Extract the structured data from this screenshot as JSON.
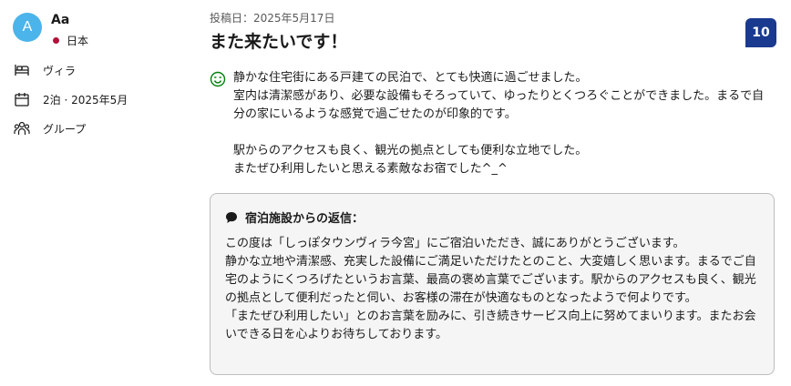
{
  "reviewer": {
    "avatar_initial": "A",
    "name": "Aa",
    "country": "日本"
  },
  "details": {
    "room_type": "ヴィラ",
    "stay": "2泊 · 2025年5月",
    "traveler_type": "グループ"
  },
  "review": {
    "posted_date": "投稿日：2025年5月17日",
    "title": "また来たいです！",
    "score": "10",
    "body": "静かな住宅街にある戸建ての民泊で、とても快適に過ごせました。\n室内は清潔感があり、必要な設備もそろっていて、ゆったりとくつろぐことができました。まるで自分の家にいるような感覚で過ごせたのが印象的です。\n\n駅からのアクセスも良く、観光の拠点としても便利な立地でした。\nまたぜひ利用したいと思える素敵なお宿でした^_^"
  },
  "reply": {
    "heading": "宿泊施設からの返信：",
    "body": "この度は「しっぽタウンヴィラ今宮」にご宿泊いただき、誠にありがとうございます。\n静かな立地や清潔感、充実した設備にご満足いただけたとのこと、大変嬉しく思います。まるでご自宅のようにくつろげたというお言葉、最高の褒め言葉でございます。駅からのアクセスも良く、観光の拠点として便利だったと伺い、お客様の滞在が快適なものとなったようで何よりです。\n「またぜひ利用したい」とのお言葉を励みに、引き続きサービス向上に努めてまいります。またお会いできる日を心よりお待ちしております。"
  },
  "colors": {
    "avatar_bg": "#4bb4ea",
    "score_bg": "#1a3a8f",
    "positive_icon": "#008009",
    "reply_bg": "#f5f5f5"
  },
  "icons": {
    "room": "bed-icon",
    "stay": "calendar-icon",
    "group": "people-icon",
    "positive": "smile-icon",
    "reply": "chat-bubble-icon"
  }
}
